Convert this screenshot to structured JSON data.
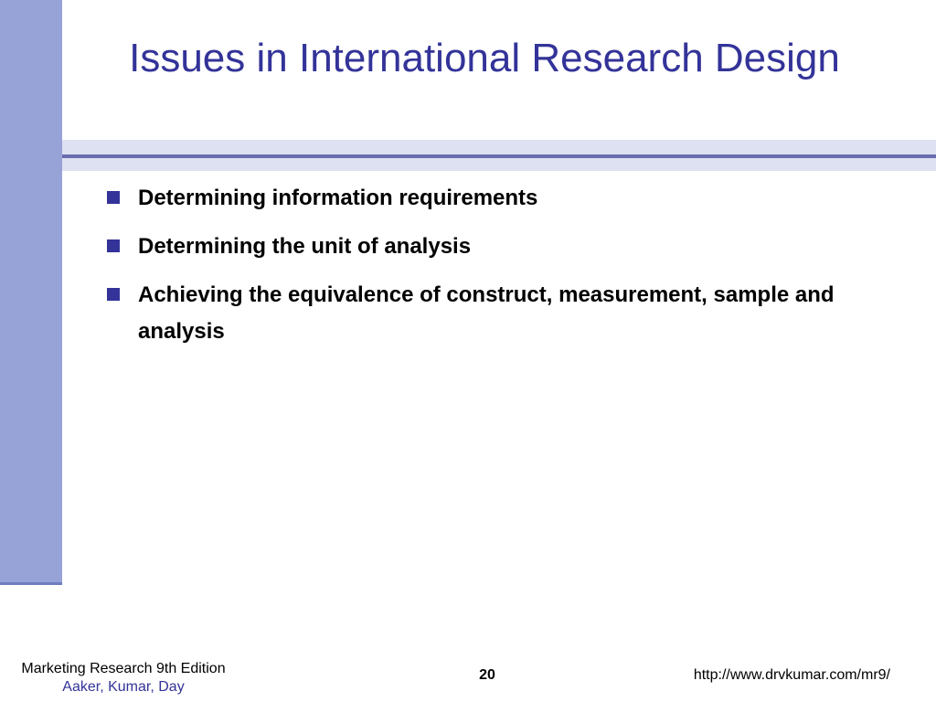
{
  "slide": {
    "title": "Issues in International Research Design",
    "bullets": [
      "Determining information requirements",
      "Determining the unit of analysis",
      "Achieving the equivalence of construct, measurement, sample and analysis"
    ]
  },
  "footer": {
    "book": "Marketing Research 9th Edition",
    "authors": "Aaker, Kumar, Day",
    "page_number": "20",
    "url": "http://www.drvkumar.com/mr9/"
  },
  "colors": {
    "title": "#333399",
    "left_bar": "#97a3d6",
    "band_light": "#dde1f2",
    "band_rule": "#6a6cae",
    "bullet": "#333399"
  }
}
